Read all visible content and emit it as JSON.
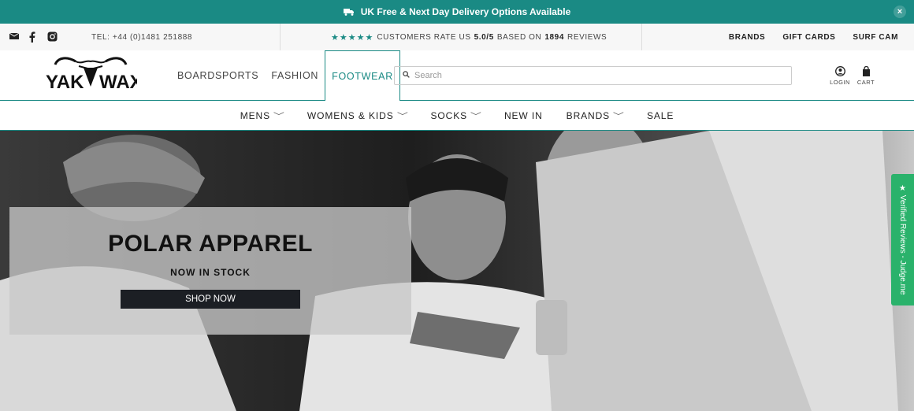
{
  "announcement": {
    "text": "UK Free & Next Day Delivery Options Available",
    "icon": "truck-icon",
    "close": "×"
  },
  "utility": {
    "social_icons": [
      "mail-icon",
      "facebook-icon",
      "instagram-icon"
    ],
    "tel": "TEL: +44 (0)1481 251888",
    "rating_stars": "★★★★★",
    "rating_prefix": "CUSTOMERS RATE US",
    "rating_value": "5.0/5",
    "rating_middle": "BASED ON",
    "rating_count": "1894",
    "rating_suffix": "REVIEWS",
    "links": [
      "BRANDS",
      "GIFT CARDS",
      "SURF CAM"
    ]
  },
  "header": {
    "logo_text": "YAK WAX",
    "nav": [
      "BOARDSPORTS",
      "FASHION",
      "FOOTWEAR"
    ],
    "active_nav": "FOOTWEAR",
    "search_placeholder": "Search",
    "login": "LOGIN",
    "cart": "CART"
  },
  "subnav": {
    "items": [
      {
        "label": "MENS",
        "chevron": "﹀"
      },
      {
        "label": "WOMENS & KIDS",
        "chevron": "﹀"
      },
      {
        "label": "SOCKS",
        "chevron": "﹀"
      },
      {
        "label": "NEW IN",
        "chevron": ""
      },
      {
        "label": "BRANDS",
        "chevron": "﹀"
      },
      {
        "label": "SALE",
        "chevron": ""
      }
    ]
  },
  "hero": {
    "title": "POLAR APPAREL",
    "subtitle": "NOW IN STOCK",
    "button": "SHOP NOW"
  },
  "side_tab": {
    "text": "★ Verified Reviews - Judge.me"
  },
  "colors": {
    "brand_teal": "#1a8a84",
    "reviews_green": "#2ab26b",
    "button_dark": "#1c1f24"
  }
}
